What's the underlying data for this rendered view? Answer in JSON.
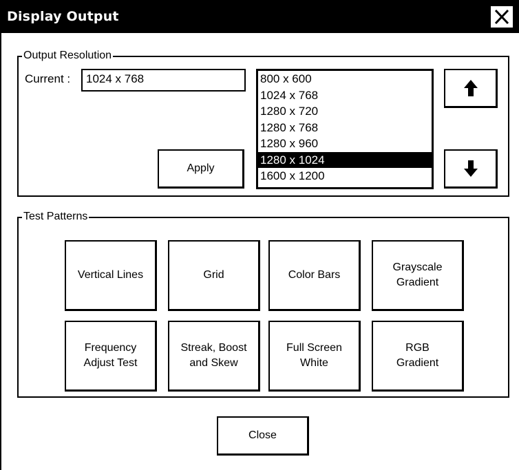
{
  "window": {
    "title": "Display Output"
  },
  "output_resolution": {
    "legend": "Output Resolution",
    "current_label": "Current :",
    "current_value": "1024 x 768",
    "apply_label": "Apply",
    "options": [
      "800 x 600",
      "1024 x 768",
      "1280 x 720",
      "1280 x 768",
      "1280 x 960",
      "1280 x 1024",
      "1600 x 1200"
    ],
    "selected_index": 5
  },
  "test_patterns": {
    "legend": "Test Patterns",
    "buttons": [
      "Vertical Lines",
      "Grid",
      "Color Bars",
      "Grayscale\nGradient",
      "Frequency\nAdjust Test",
      "Streak, Boost\nand Skew",
      "Full Screen\nWhite",
      "RGB\nGradient"
    ]
  },
  "footer": {
    "close_label": "Close"
  }
}
